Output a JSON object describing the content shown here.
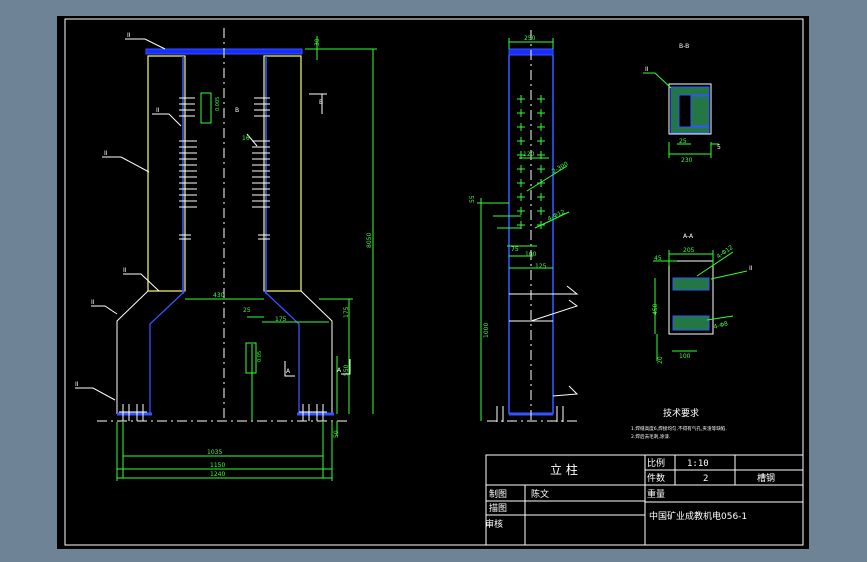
{
  "drawing": {
    "labels": {
      "ii": "II",
      "b_mark": "B",
      "a_mark": "A",
      "dim_30": "30",
      "dim_8050": "8050",
      "dim_430": "430",
      "dim_25": "25",
      "dim_175": "175",
      "dim_550": "550",
      "dim_50": "50",
      "dim_1035": "1035",
      "dim_1150": "1150",
      "dim_1240": "1240",
      "tol_0005": "0.005",
      "tol_005": "0.05",
      "dim_16": "16",
      "dim_250": "250",
      "dim_120": "120",
      "dim_75": "75",
      "dim_100": "100",
      "dim_125": "125",
      "dim_1000": "1000",
      "dim_55": "55",
      "dim_2_300": "2-300",
      "dim_4_12": "4-Φ12",
      "section_b": "B-B",
      "section_a": "A-A",
      "dim_230": "230",
      "dim_5": "5",
      "dim_25b": "25",
      "dim_205": "205",
      "dim_45": "45",
      "dim_450": "450",
      "dim_4_012": "4-Φ12",
      "dim_4_8": "4-Φ8",
      "dim_20": "20",
      "dim_100b": "100",
      "tech_title": "技术要求",
      "tech_line1": "1.焊缝高度6,焊接均匀,不得有气孔,夹渣等缺陷.",
      "tech_line2": "2.焊后去毛刺,涂漆."
    }
  },
  "title_block": {
    "part_name": "立  柱",
    "scale_label": "比例",
    "scale_value": "1:10",
    "qty_label": "件数",
    "qty_value": "2",
    "material": "槽钢",
    "weight_label": "重量",
    "drawn_label": "制图",
    "drawn_by": "陈文",
    "traced_label": "描图",
    "checked_label": "审核",
    "drawing_no": "中国矿业成教机电056-1"
  }
}
